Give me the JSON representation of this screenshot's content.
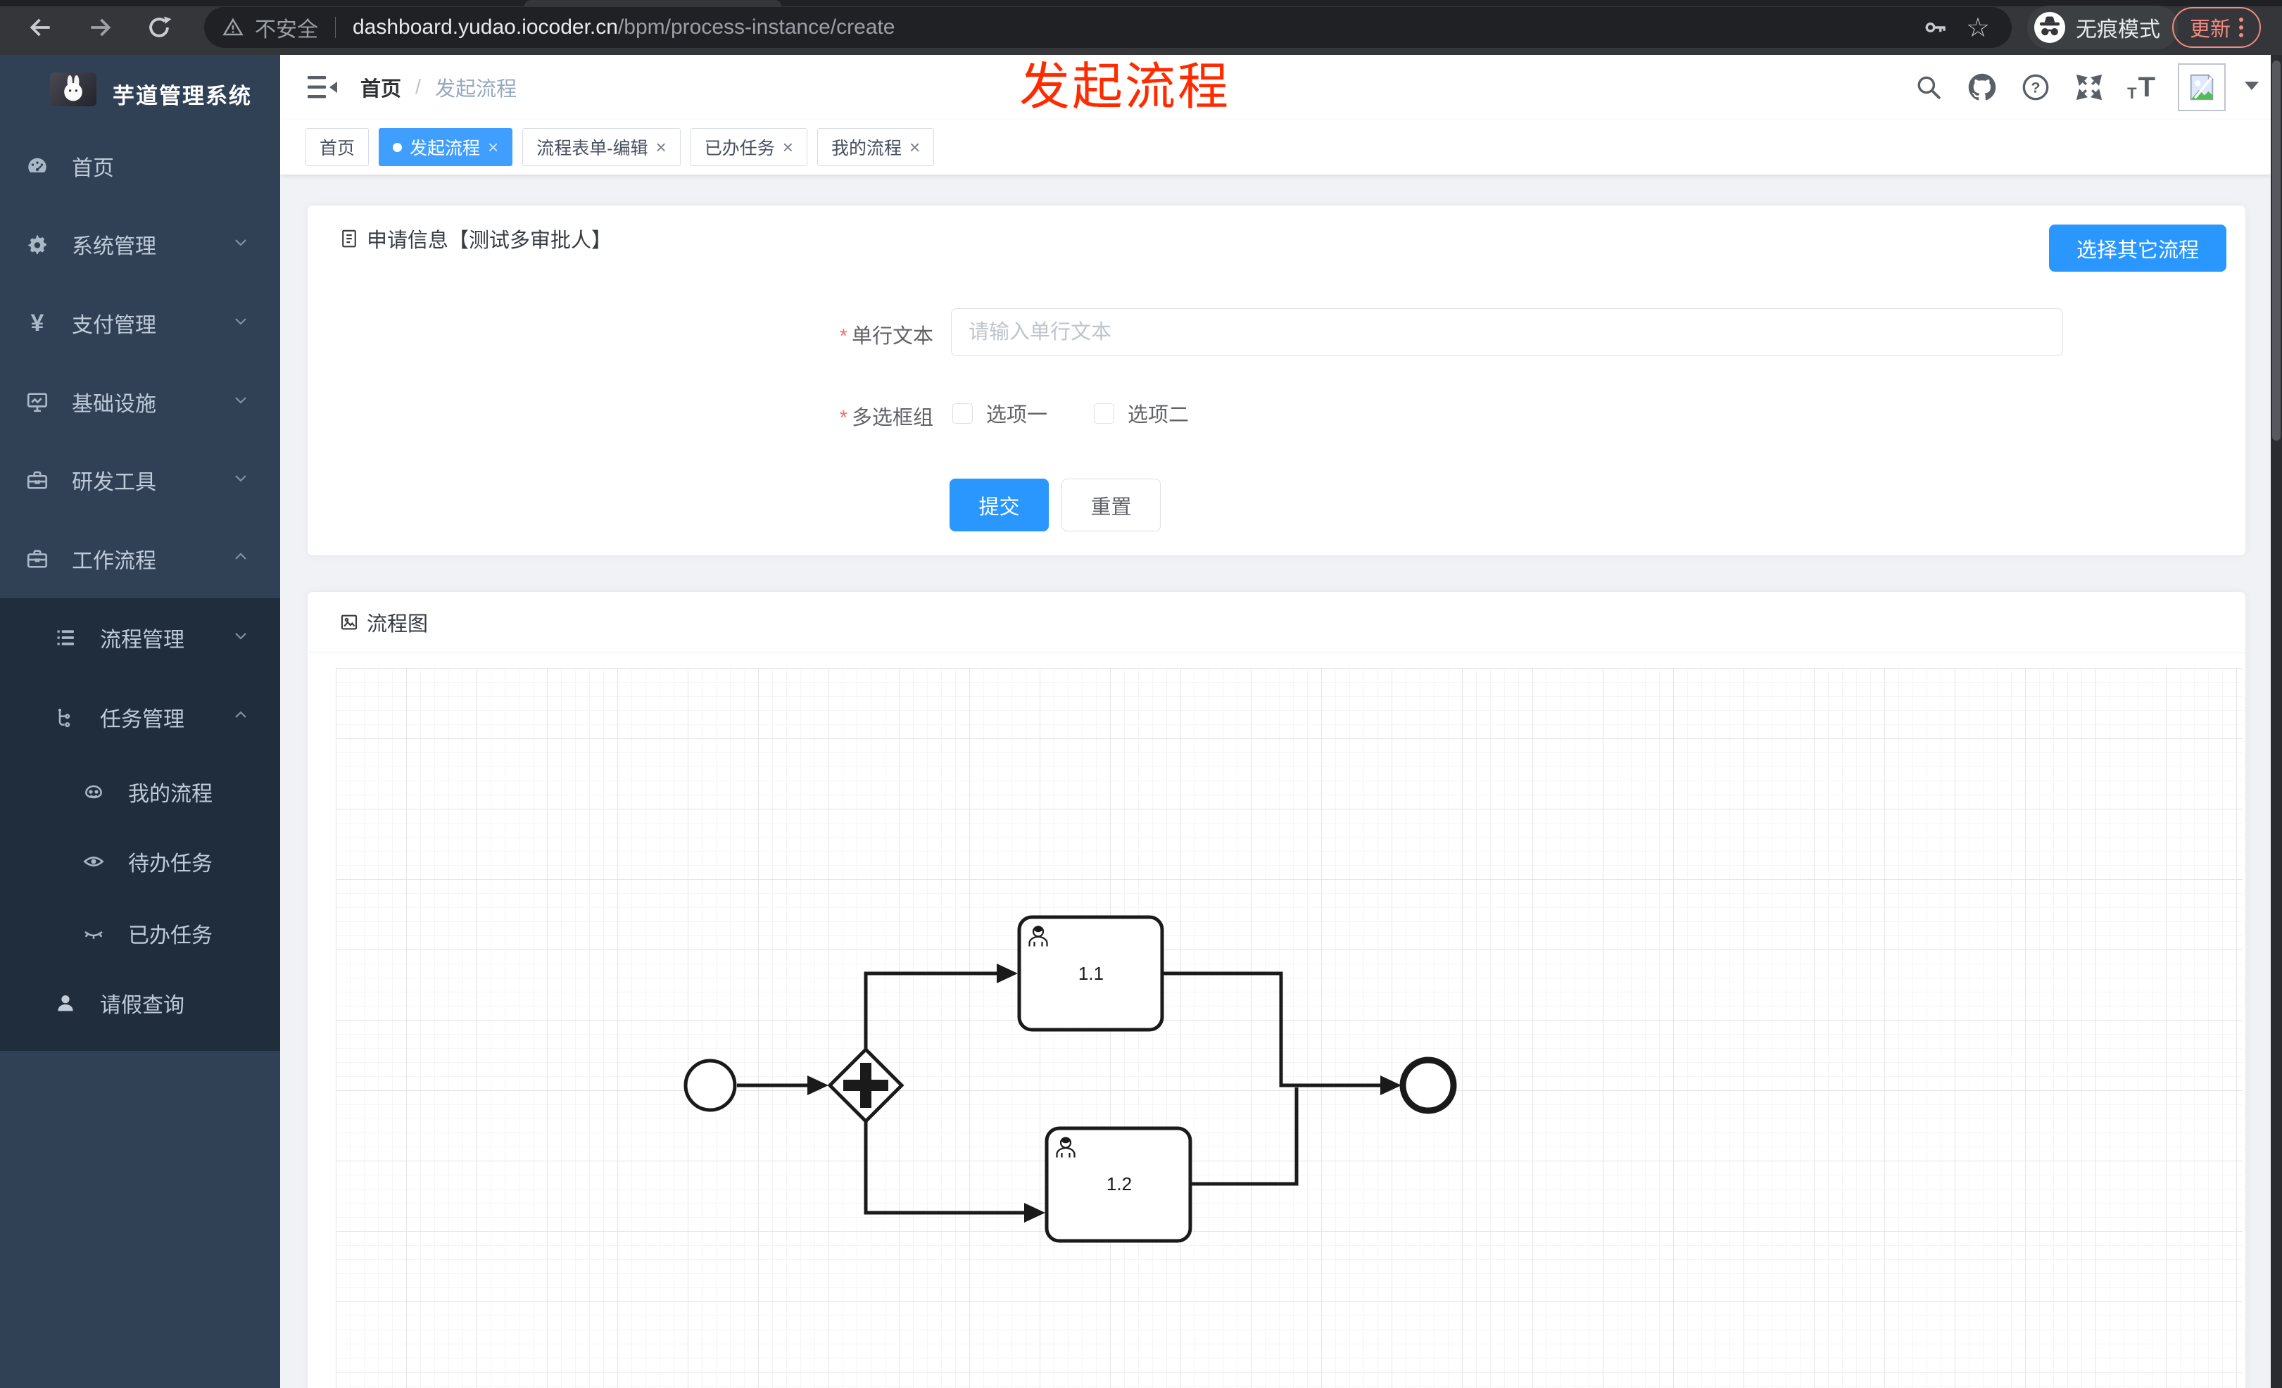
{
  "browser": {
    "security_label": "不安全",
    "url_domain": "dashboard.yudao.iocoder.cn",
    "url_path": "/bpm/process-instance/create",
    "incognito_label": "无痕模式",
    "update_label": "更新"
  },
  "annotation": {
    "text": "发起流程"
  },
  "sidebar": {
    "title": "芋道管理系统",
    "items": [
      {
        "label": "首页",
        "icon": "dashboard-icon"
      },
      {
        "label": "系统管理",
        "icon": "gear-icon",
        "chevron": "down"
      },
      {
        "label": "支付管理",
        "icon": "yen-icon",
        "chevron": "down"
      },
      {
        "label": "基础设施",
        "icon": "monitor-icon",
        "chevron": "down"
      },
      {
        "label": "研发工具",
        "icon": "toolbox-icon",
        "chevron": "down"
      },
      {
        "label": "工作流程",
        "icon": "suitcase-icon",
        "chevron": "up"
      }
    ],
    "submenu_items": [
      {
        "label": "流程管理",
        "icon": "list-icon",
        "chevron": "down"
      },
      {
        "label": "任务管理",
        "icon": "tree-icon",
        "chevron": "up"
      }
    ],
    "task_children": [
      {
        "label": "我的流程",
        "icon": "robot-icon"
      },
      {
        "label": "待办任务",
        "icon": "eye-open-icon"
      },
      {
        "label": "已办任务",
        "icon": "eye-closed-icon"
      }
    ],
    "leaf": {
      "label": "请假查询",
      "icon": "user-icon"
    }
  },
  "breadcrumb": {
    "items": [
      "首页",
      "发起流程"
    ],
    "separator": "/"
  },
  "tabs": [
    {
      "label": "首页",
      "active": false,
      "closable": false
    },
    {
      "label": "发起流程",
      "active": true,
      "closable": true
    },
    {
      "label": "流程表单-编辑",
      "active": false,
      "closable": true
    },
    {
      "label": "已办任务",
      "active": false,
      "closable": true
    },
    {
      "label": "我的流程",
      "active": false,
      "closable": true
    }
  ],
  "form": {
    "title": "申请信息【测试多审批人】",
    "choose_other": "选择其它流程",
    "fields": [
      {
        "label": "单行文本",
        "required": true,
        "placeholder": "请输入单行文本"
      },
      {
        "label": "多选框组",
        "required": true,
        "options": [
          "选项一",
          "选项二"
        ],
        "checked": [
          false,
          false
        ]
      }
    ],
    "submit": "提交",
    "reset": "重置"
  },
  "flow": {
    "title": "流程图",
    "diagram_type": "bpmn",
    "nodes": {
      "start_event": "",
      "gateway": "parallel",
      "tasks": [
        {
          "label": "1.1"
        },
        {
          "label": "1.2"
        }
      ],
      "end_event": ""
    }
  },
  "ui": {
    "close_glyph": "×",
    "required_mark": "*",
    "help_glyph": "?",
    "star_glyph": "☆",
    "t_small": "T",
    "t_large": "T"
  },
  "colors": {
    "primary": "#409eff",
    "button_blue": "#2a97ff",
    "sidebar_bg": "#304156",
    "submenu_bg": "#1f2d3d",
    "sidebar_text": "#bfcbd9",
    "annotation_red": "#ff2b00",
    "chrome_bg": "#35363a",
    "omnibox_bg": "#202124",
    "update_outline": "#f28b82",
    "tab_active": "#409eff"
  },
  "icons": {
    "back": "arrow-left",
    "forward": "arrow-right",
    "reload": "circular-arrow",
    "home": "house",
    "warning": "triangle-exclaim",
    "key": "key",
    "star": "☆",
    "incognito": "hat-and-glasses",
    "menu-dots": "⋮",
    "search": "magnifier",
    "github": "octocat",
    "help": "?",
    "fullscreen": "four-arrows",
    "font-size": "tT",
    "avatar": "broken-image-placeholder",
    "caret-down": "▼",
    "hamburger": "bars-with-arrow",
    "document": "doc-sheet",
    "image": "picture-frame",
    "bpmn-user-task": "person"
  }
}
